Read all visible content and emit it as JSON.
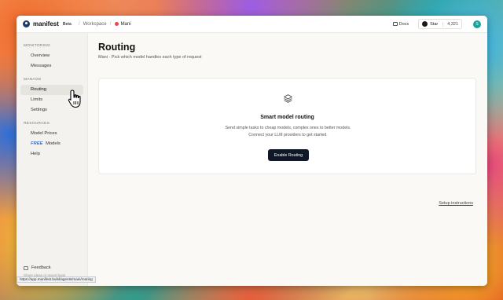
{
  "topbar": {
    "brand": "manifest",
    "beta": "Beta",
    "workspace": "Workspace",
    "agent": "Mani",
    "docs_label": "Docs",
    "star_label": "Star",
    "star_count": "4,321",
    "avatar_initial": "S"
  },
  "sidebar": {
    "sections": [
      {
        "label": "MONITORING",
        "items": [
          "Overview",
          "Messages"
        ]
      },
      {
        "label": "MANAGE",
        "items": [
          "Routing",
          "Limits",
          "Settings"
        ]
      },
      {
        "label": "RESOURCES",
        "items": [
          "Model Prices",
          "Models",
          "Help"
        ]
      }
    ],
    "active_item": "Routing",
    "free_tag": "FREE",
    "feedback_label": "Feedback",
    "feedback_sub": "Share ideas or report bugs"
  },
  "main": {
    "title": "Routing",
    "subtitle": "Mani · Pick which model handles each type of request",
    "card": {
      "title": "Smart model routing",
      "description": "Send simple tasks to cheap models, complex ones to better models. Connect your LLM providers to get started.",
      "button_label": "Enable Routing"
    },
    "setup_link": "Setup instructions"
  },
  "status_url": "https://app.manifest.build/agents/mani/routing",
  "colors": {
    "active_bg": "#e6e4de",
    "button_bg": "#101828",
    "agent_dot": "#e5484d",
    "avatar": "#1aa39a",
    "free_tag": "#2f6fd6"
  },
  "icons": [
    "logo-icon",
    "book-icon",
    "github-icon",
    "layers-icon",
    "feedback-icon",
    "hand-cursor-icon"
  ]
}
